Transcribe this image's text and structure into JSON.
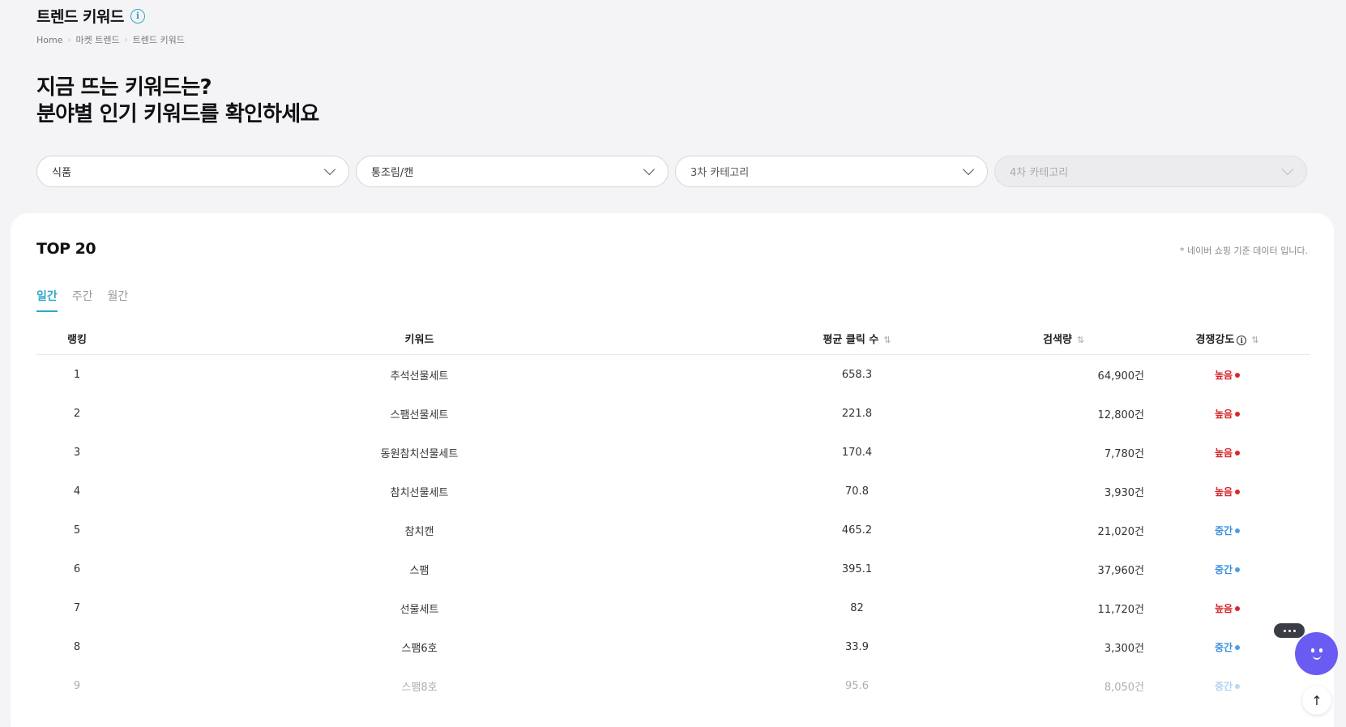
{
  "header": {
    "title": "트렌드 키워드",
    "breadcrumb": [
      "Home",
      "마켓 트렌드",
      "트렌드 키워드"
    ]
  },
  "hero": {
    "line1": "지금 뜨는 키워드는?",
    "line2": "분야별 인기 키워드를 확인하세요"
  },
  "filters": [
    {
      "value": "식품",
      "disabled": false
    },
    {
      "value": "통조림/캔",
      "disabled": false
    },
    {
      "value": "3차 카테고리",
      "disabled": false
    },
    {
      "value": "4차 카테고리",
      "disabled": true
    }
  ],
  "card": {
    "title": "TOP 20",
    "note": "* 네이버 쇼핑 기준 데이터 입니다.",
    "tabs": [
      "일간",
      "주간",
      "월간"
    ],
    "active_tab": "일간"
  },
  "table": {
    "headers": {
      "rank": "랭킹",
      "keyword": "키워드",
      "clicks": "평균 클릭 수",
      "volume": "검색량",
      "competition": "경쟁강도"
    },
    "rows": [
      {
        "rank": "1",
        "keyword": "추석선물세트",
        "clicks": "658.3",
        "volume": "64,900건",
        "competition": "높음",
        "level": "high"
      },
      {
        "rank": "2",
        "keyword": "스팸선물세트",
        "clicks": "221.8",
        "volume": "12,800건",
        "competition": "높음",
        "level": "high"
      },
      {
        "rank": "3",
        "keyword": "동원참치선물세트",
        "clicks": "170.4",
        "volume": "7,780건",
        "competition": "높음",
        "level": "high"
      },
      {
        "rank": "4",
        "keyword": "참치선물세트",
        "clicks": "70.8",
        "volume": "3,930건",
        "competition": "높음",
        "level": "high"
      },
      {
        "rank": "5",
        "keyword": "참치캔",
        "clicks": "465.2",
        "volume": "21,020건",
        "competition": "중간",
        "level": "mid"
      },
      {
        "rank": "6",
        "keyword": "스팸",
        "clicks": "395.1",
        "volume": "37,960건",
        "competition": "중간",
        "level": "mid"
      },
      {
        "rank": "7",
        "keyword": "선물세트",
        "clicks": "82",
        "volume": "11,720건",
        "competition": "높음",
        "level": "high"
      },
      {
        "rank": "8",
        "keyword": "스팸6호",
        "clicks": "33.9",
        "volume": "3,300건",
        "competition": "중간",
        "level": "mid"
      },
      {
        "rank": "9",
        "keyword": "스팸8호",
        "clicks": "95.6",
        "volume": "8,050건",
        "competition": "중간",
        "level": "mid"
      }
    ]
  },
  "colors": {
    "accent": "#2ea7c6",
    "high": "#d8262b",
    "mid": "#3a8fe0",
    "chatbot": "#6a5cf3"
  }
}
